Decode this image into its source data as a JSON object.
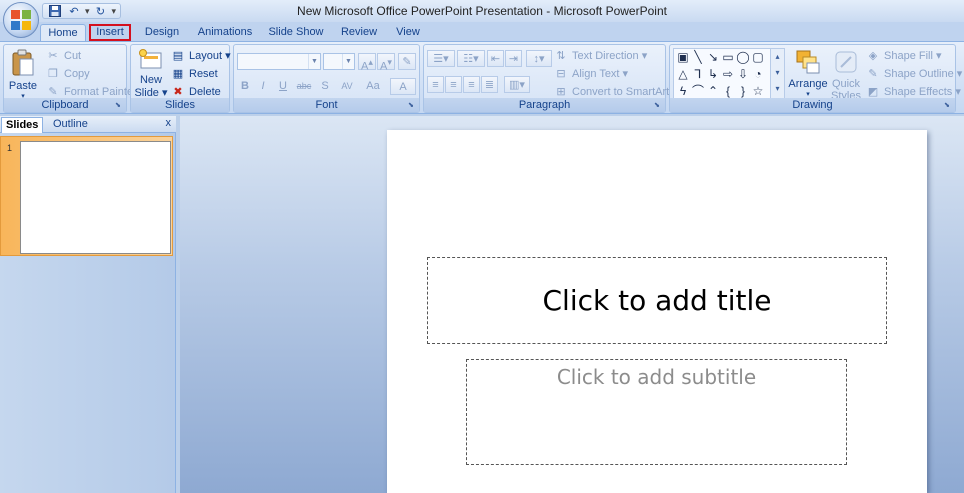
{
  "window": {
    "title": "New Microsoft Office PowerPoint Presentation - Microsoft PowerPoint"
  },
  "qat": {
    "separator": "▾"
  },
  "tabs": [
    {
      "label": "Home"
    },
    {
      "label": "Insert"
    },
    {
      "label": "Design"
    },
    {
      "label": "Animations"
    },
    {
      "label": "Slide Show"
    },
    {
      "label": "Review"
    },
    {
      "label": "View"
    }
  ],
  "ribbon": {
    "clipboard": {
      "label": "Clipboard",
      "paste": "Paste",
      "cut": "Cut",
      "copy": "Copy",
      "format_painter": "Format Painter"
    },
    "slides": {
      "label": "Slides",
      "new_slide_line1": "New",
      "new_slide_line2": "Slide ▾",
      "layout": "Layout ▾",
      "reset": "Reset",
      "delete": "Delete"
    },
    "font": {
      "label": "Font",
      "bold": "B",
      "italic": "I",
      "underline": "U",
      "strike": "abc",
      "shadow": "S",
      "spacing": "AV",
      "change_case": "Aa",
      "color": "A"
    },
    "paragraph": {
      "label": "Paragraph",
      "text_direction": "Text Direction ▾",
      "align_text": "Align Text ▾",
      "convert_smartart": "Convert to SmartArt ▾"
    },
    "drawing": {
      "label": "Drawing",
      "arrange": "Arrange",
      "quick_styles_line1": "Quick",
      "quick_styles_line2": "Styles ▾",
      "shape_fill": "Shape Fill ▾",
      "shape_outline": "Shape Outline ▾",
      "shape_effects": "Shape Effects ▾"
    }
  },
  "panel": {
    "tabs": [
      {
        "label": "Slides"
      },
      {
        "label": "Outline"
      }
    ],
    "close": "x",
    "slide_number": "1"
  },
  "slide": {
    "title_placeholder": "Click to add title",
    "subtitle_placeholder": "Click to add subtitle"
  },
  "colors": {
    "highlight": "#d4101e",
    "ribbon": "#d5e3f6",
    "selected_thumb": "#f8b55a"
  }
}
